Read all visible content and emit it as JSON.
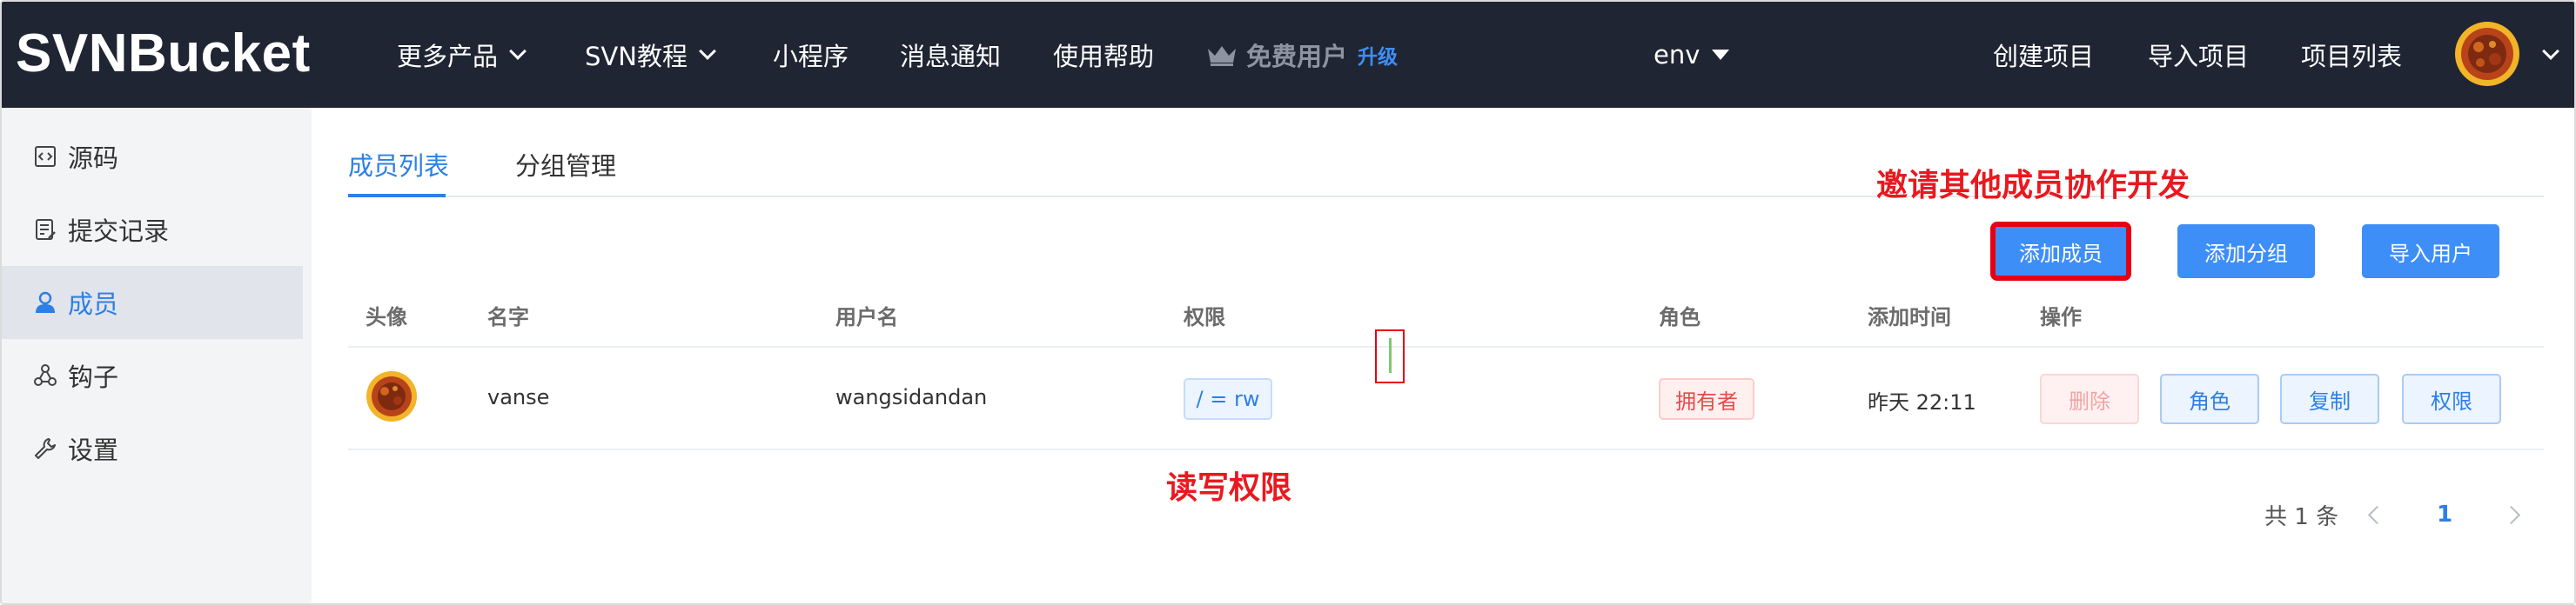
{
  "brand": {
    "logo": "SVNBucket"
  },
  "topnav": {
    "more_products": "更多产品",
    "svn_tutorial": "SVN教程",
    "mini_program": "小程序",
    "notifications": "消息通知",
    "help": "使用帮助",
    "free_user": "免费用户",
    "upgrade": "升级",
    "env": "env",
    "create_project": "创建项目",
    "import_project": "导入项目",
    "project_list": "项目列表"
  },
  "sidebar": {
    "items": [
      {
        "label": "源码",
        "icon": "code-file-icon",
        "active": false
      },
      {
        "label": "提交记录",
        "icon": "commit-log-icon",
        "active": false
      },
      {
        "label": "成员",
        "icon": "user-icon",
        "active": true
      },
      {
        "label": "钩子",
        "icon": "webhook-icon",
        "active": false
      },
      {
        "label": "设置",
        "icon": "wrench-icon",
        "active": false
      }
    ]
  },
  "tabs": [
    {
      "label": "成员列表",
      "active": true
    },
    {
      "label": "分组管理",
      "active": false
    }
  ],
  "annotations": {
    "invite": "邀请其他成员协作开发",
    "rw_perm": "读写权限"
  },
  "actions": {
    "add_member": "添加成员",
    "add_group": "添加分组",
    "import_users": "导入用户"
  },
  "table": {
    "headers": [
      "头像",
      "名字",
      "用户名",
      "权限",
      "角色",
      "添加时间",
      "操作"
    ],
    "rows": [
      {
        "name": "vanse",
        "username": "wangsidandan",
        "permission": "/ = rw",
        "role": "拥有者",
        "added": "昨天 22:11",
        "ops": {
          "delete": "删除",
          "role": "角色",
          "copy": "复制",
          "perm": "权限"
        }
      }
    ]
  },
  "pagination": {
    "total": "共 1 条",
    "current": "1"
  },
  "colors": {
    "navbar": "#1f2533",
    "primary": "#3e8ef7",
    "active_text": "#2d7fe6",
    "annotation_red": "#e8191f",
    "sidebar_bg": "#f3f4f6"
  }
}
